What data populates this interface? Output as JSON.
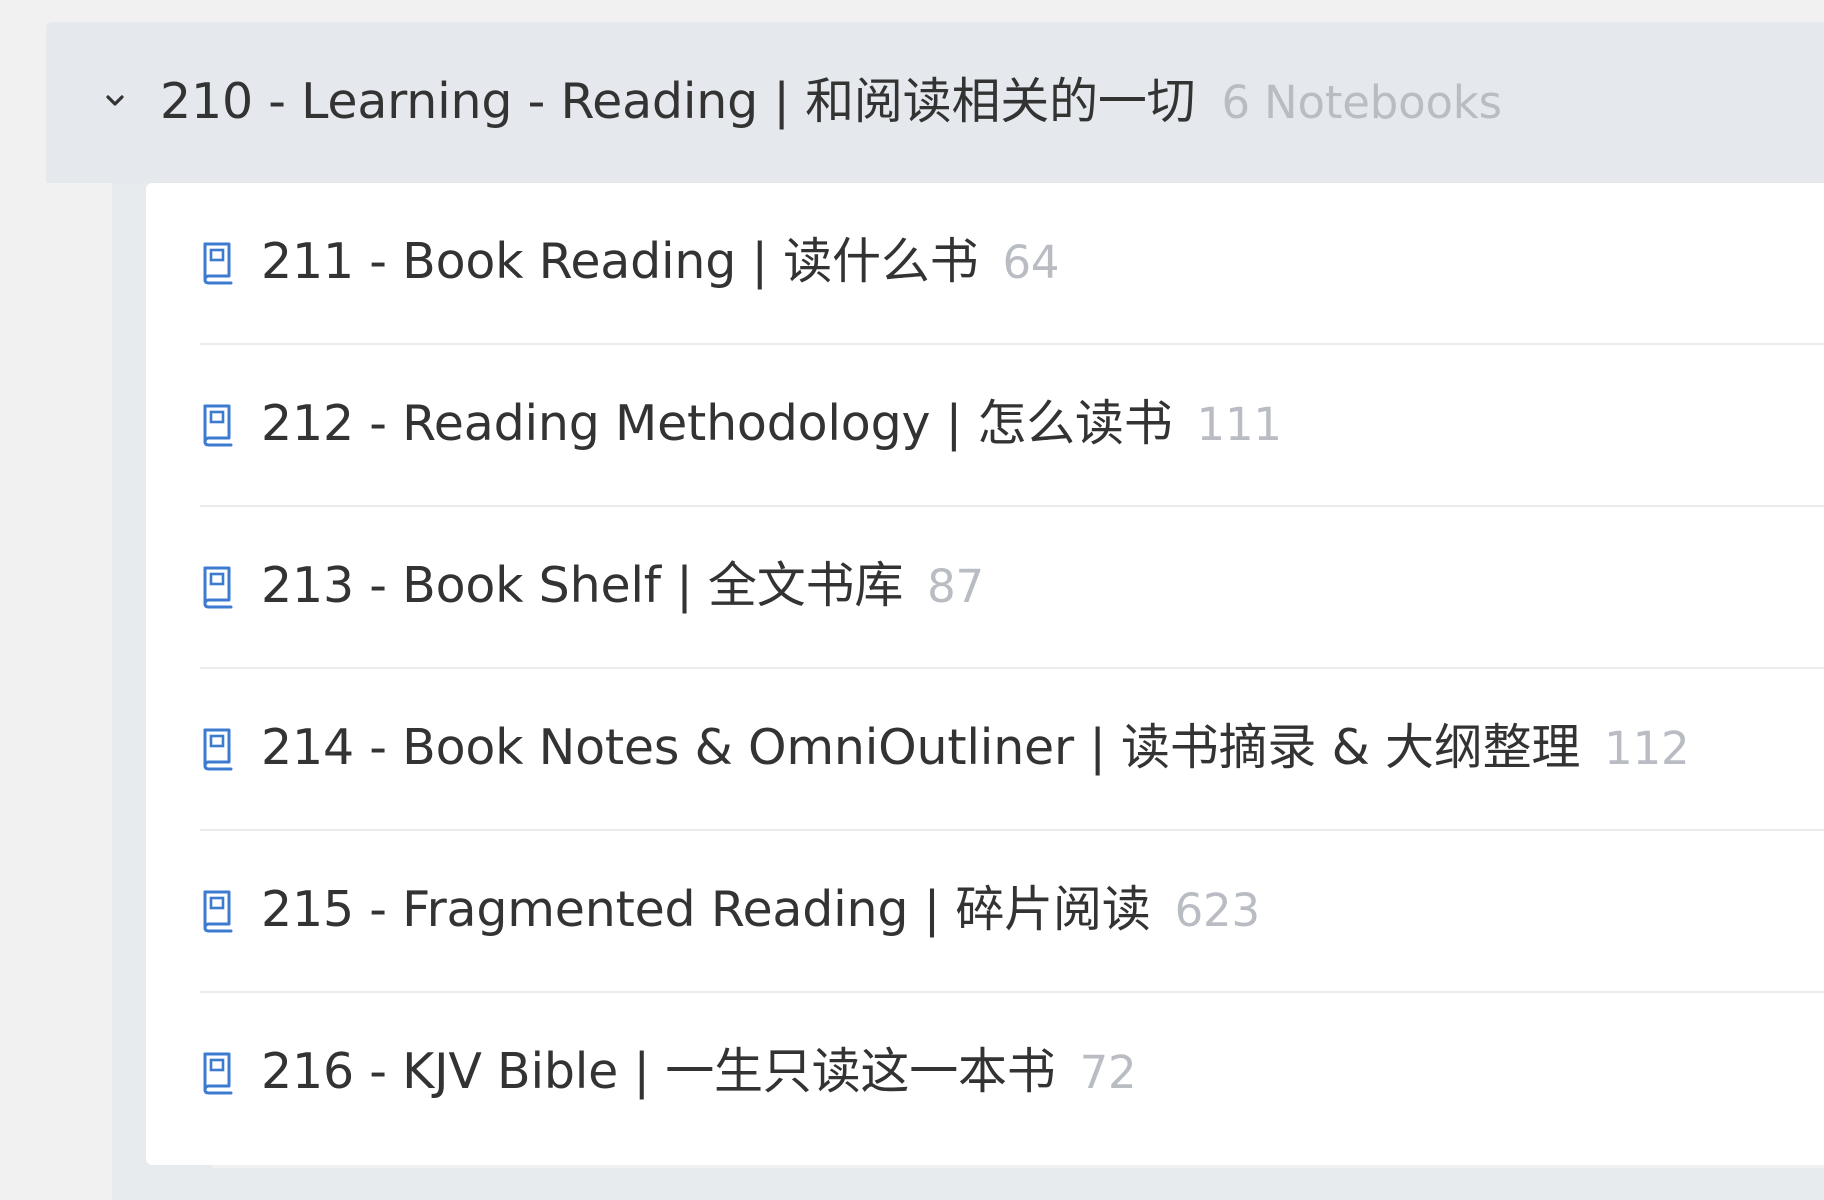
{
  "stack": {
    "title": "210 - Learning - Reading | 和阅读相关的一切",
    "count_label": "6 Notebooks",
    "expanded_icon": "chevron-down-icon"
  },
  "notebooks": [
    {
      "title": "211 - Book Reading | 读什么书",
      "count": "64",
      "icon": "notebook-icon"
    },
    {
      "title": "212 - Reading Methodology | 怎么读书",
      "count": "111",
      "icon": "notebook-icon"
    },
    {
      "title": "213 - Book Shelf | 全文书库",
      "count": "87",
      "icon": "notebook-icon"
    },
    {
      "title": "214 - Book Notes & OmniOutliner | 读书摘录 & 大纲整理",
      "count": "112",
      "icon": "notebook-icon"
    },
    {
      "title": "215 - Fragmented Reading | 碎片阅读",
      "count": "623",
      "icon": "notebook-icon"
    },
    {
      "title": "216 - KJV Bible | 一生只读这一本书",
      "count": "72",
      "icon": "notebook-icon"
    }
  ],
  "colors": {
    "icon_blue": "#3d7bd1",
    "text_primary": "#333333",
    "text_count": "#b9bdc3",
    "stack_background": "#e5e8ec"
  }
}
